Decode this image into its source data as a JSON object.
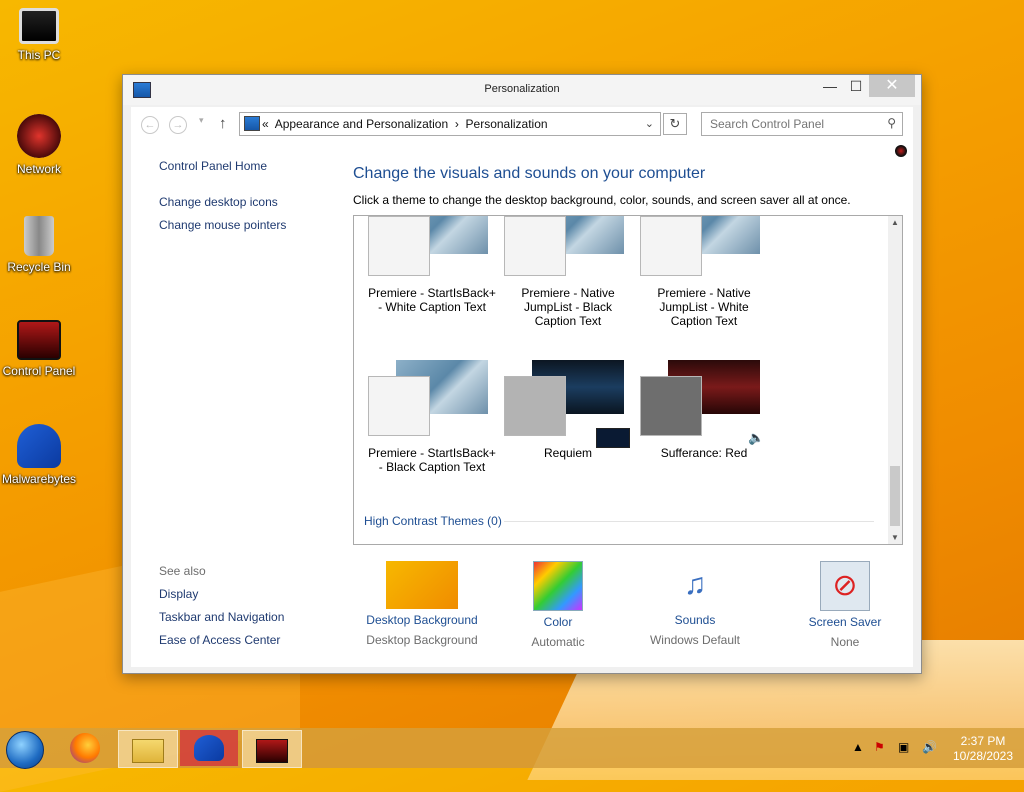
{
  "desktop": {
    "icons": [
      {
        "label": "This PC"
      },
      {
        "label": "Network"
      },
      {
        "label": "Recycle Bin"
      },
      {
        "label": "Control Panel"
      },
      {
        "label": "Malwarebytes"
      }
    ]
  },
  "window": {
    "title": "Personalization",
    "controls": {
      "minimize": "—",
      "maximize": "☐",
      "close": "✕"
    }
  },
  "navbar": {
    "address_prefix": "«",
    "crumb1": "Appearance and Personalization",
    "separator": "›",
    "crumb2": "Personalization",
    "search_placeholder": "Search Control Panel"
  },
  "left_pane": {
    "home": "Control Panel Home",
    "links": [
      "Change desktop icons",
      "Change mouse pointers"
    ],
    "see_also_label": "See also",
    "see_also": [
      "Display",
      "Taskbar and Navigation",
      "Ease of Access Center"
    ]
  },
  "main": {
    "title": "Change the visuals and sounds on your computer",
    "subtitle": "Click a theme to change the desktop background, color, sounds, and screen saver all at once.",
    "themes": [
      {
        "name": "Premiere - StartIsBack+ - White Caption Text"
      },
      {
        "name": "Premiere - Native JumpList - Black Caption Text"
      },
      {
        "name": "Premiere - Native JumpList - White Caption Text"
      },
      {
        "name": "Premiere - StartIsBack+ - Black Caption Text"
      },
      {
        "name": "Requiem"
      },
      {
        "name": "Sufferance: Red"
      }
    ],
    "high_contrast": "High Contrast Themes (0)"
  },
  "bottom": [
    {
      "label": "Desktop Background",
      "sub": "Desktop Background"
    },
    {
      "label": "Color",
      "sub": "Automatic"
    },
    {
      "label": "Sounds",
      "sub": "Windows Default"
    },
    {
      "label": "Screen Saver",
      "sub": "None"
    }
  ],
  "taskbar": {
    "time": "2:37 PM",
    "date": "10/28/2023"
  }
}
